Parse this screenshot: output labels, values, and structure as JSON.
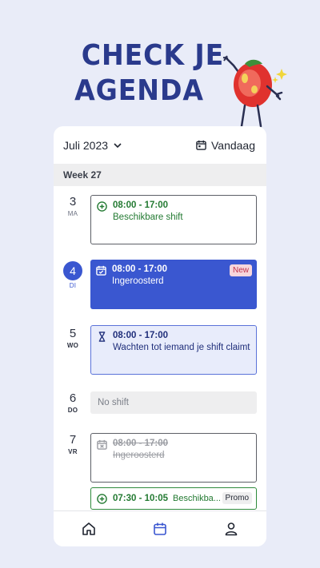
{
  "headline": {
    "line1": "CHECK JE",
    "line2": "AGENDA"
  },
  "topbar": {
    "month": "Juli 2023",
    "today_label": "Vandaag"
  },
  "week_label": "Week 27",
  "days": [
    {
      "num": "3",
      "name": "MA",
      "shift": {
        "type": "available",
        "time": "08:00 - 17:00",
        "label": "Beschikbare shift"
      }
    },
    {
      "num": "4",
      "name": "DI",
      "today": true,
      "shift": {
        "type": "scheduled",
        "time": "08:00 - 17:00",
        "label": "Ingeroosterd",
        "badge": "New"
      }
    },
    {
      "num": "5",
      "name": "WO",
      "shift": {
        "type": "waiting",
        "time": "08:00 - 17:00",
        "label": "Wachten tot iemand je shift claimt"
      }
    },
    {
      "num": "6",
      "name": "DO",
      "shift": {
        "type": "none",
        "label": "No shift"
      }
    },
    {
      "num": "7",
      "name": "VR",
      "shift": {
        "type": "cancelled",
        "time": "08:00 - 17:00",
        "label": "Ingeroosterd"
      },
      "promo": {
        "time": "07:30 - 10:05",
        "label": "Beschikba...",
        "badge": "Promo"
      }
    }
  ],
  "colors": {
    "accent": "#3a57d0",
    "headline": "#2a3a8c",
    "available": "#237a32",
    "background": "#e9ecf8"
  },
  "tabs": [
    "home-icon",
    "calendar-icon",
    "profile-icon"
  ]
}
